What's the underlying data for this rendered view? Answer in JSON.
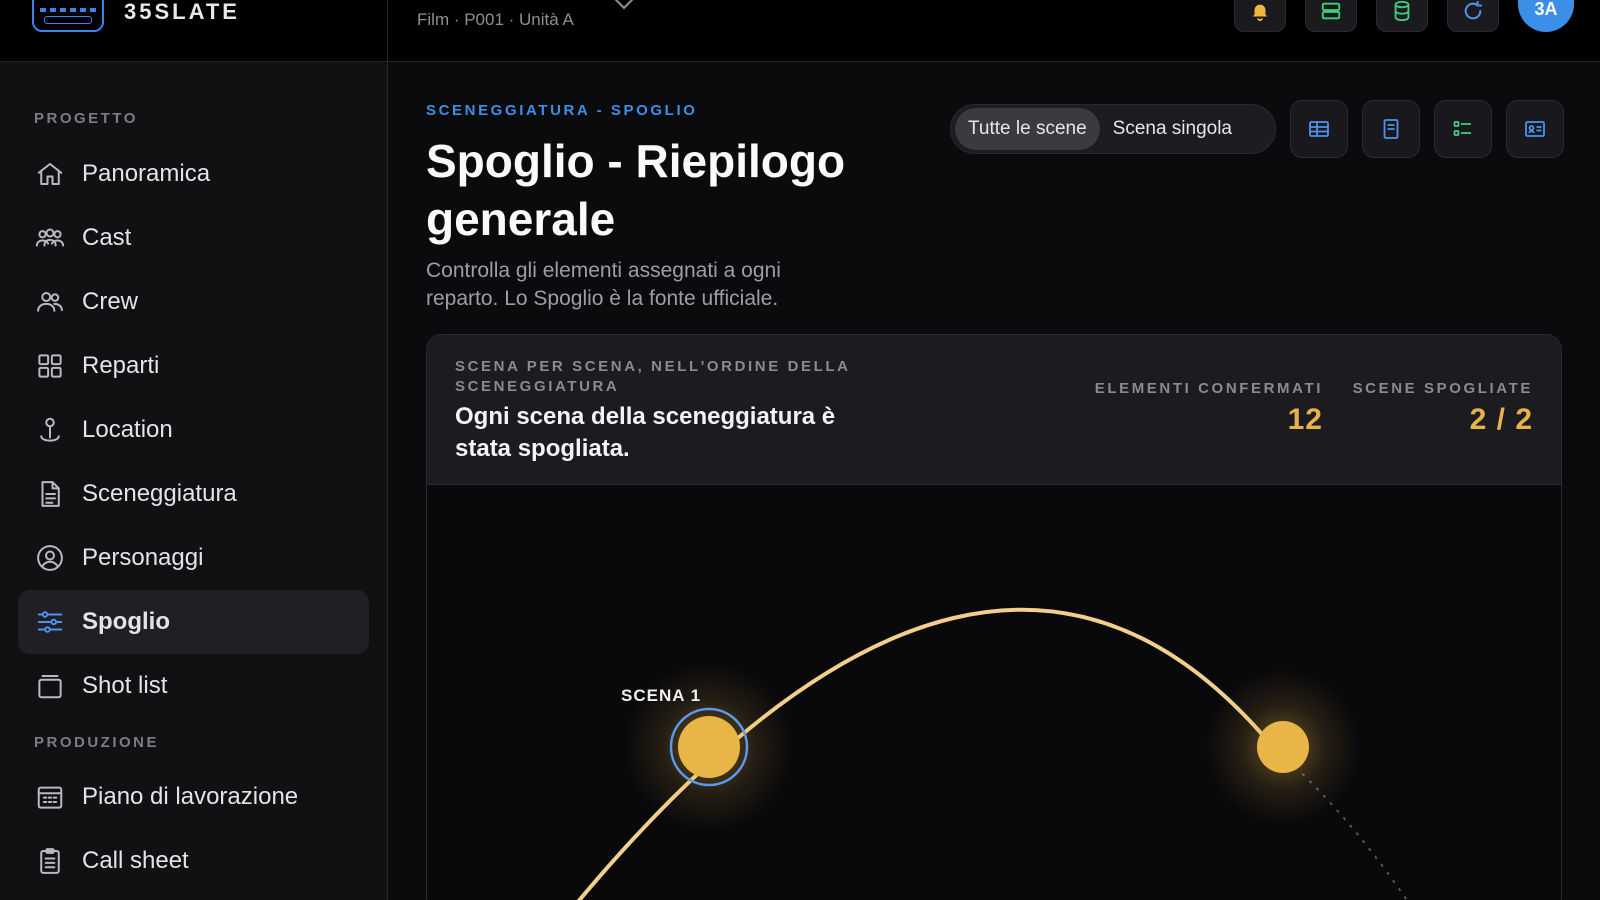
{
  "brand": {
    "name": "35SLATE"
  },
  "project": {
    "meta": "Film · P001 · Unità A"
  },
  "topbar": {
    "icons": [
      "bell-icon",
      "server-icon",
      "database-icon",
      "refresh-icon"
    ],
    "avatar": "3A"
  },
  "sidebar": {
    "section_project": "PROGETTO",
    "section_production": "PRODUZIONE",
    "items": [
      {
        "label": "Panoramica",
        "icon": "home-icon"
      },
      {
        "label": "Cast",
        "icon": "cast-icon"
      },
      {
        "label": "Crew",
        "icon": "crew-icon"
      },
      {
        "label": "Reparti",
        "icon": "grid-icon"
      },
      {
        "label": "Location",
        "icon": "location-pin-icon"
      },
      {
        "label": "Sceneggiatura",
        "icon": "document-icon"
      },
      {
        "label": "Personaggi",
        "icon": "person-circle-icon"
      },
      {
        "label": "Spoglio",
        "icon": "sliders-icon",
        "active": true
      },
      {
        "label": "Shot list",
        "icon": "stack-icon"
      }
    ],
    "production_items": [
      {
        "label": "Piano di lavorazione",
        "icon": "calendar-icon"
      },
      {
        "label": "Call sheet",
        "icon": "clipboard-icon"
      }
    ]
  },
  "main": {
    "breadcrumb": "SCENEGGIATURA - SPOGLIO",
    "title": "Spoglio - Riepilogo generale",
    "description": "Controlla gli elementi assegnati a ogni reparto. Lo Spoglio è la fonte ufficiale.",
    "segmented": {
      "all": "Tutte le scene",
      "single": "Scena singola",
      "selected": "all"
    },
    "view_buttons": [
      "table-view-icon",
      "page-view-icon",
      "list-view-icon",
      "card-view-icon"
    ]
  },
  "panel": {
    "kicker": "SCENA PER SCENA, NELL'ORDINE DELLA SCENEGGIATURA",
    "message": "Ogni scena della sceneggiatura è stata spogliata.",
    "stats": [
      {
        "label": "ELEMENTI CONFERMATI",
        "value": "12"
      },
      {
        "label": "SCENE SPOGLIATE",
        "value": "2 / 2"
      }
    ],
    "scenes": [
      {
        "label": "SCENA 1",
        "selected": true
      },
      {
        "label": "",
        "selected": false
      }
    ]
  },
  "colors": {
    "accent_blue": "#3f8ee8",
    "scene_gold": "#e8b24a",
    "background": "#0b0b0e",
    "sidebar_bg": "#111114"
  }
}
